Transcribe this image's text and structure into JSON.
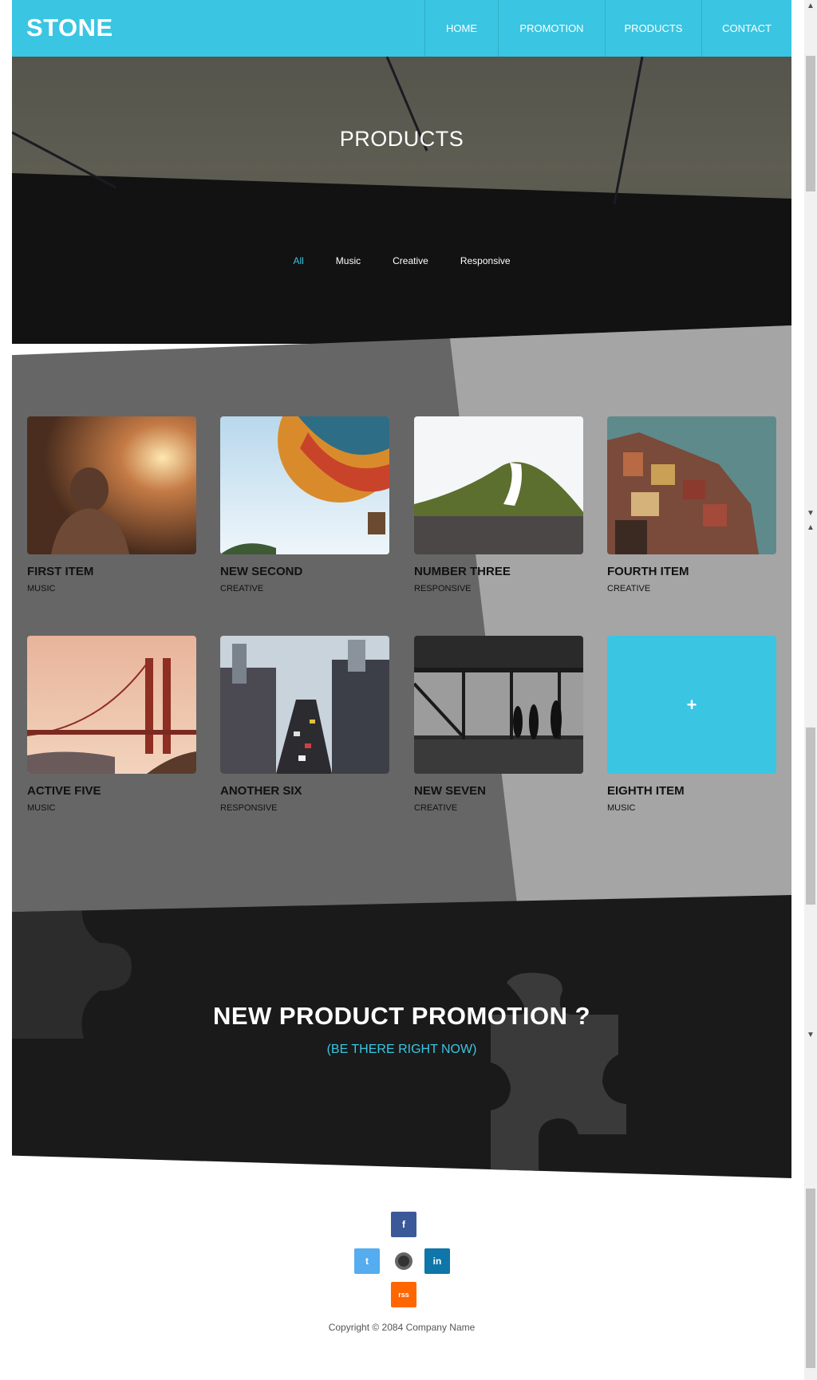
{
  "brand": "STONE",
  "nav": [
    "HOME",
    "PROMOTION",
    "PRODUCTS",
    "CONTACT"
  ],
  "hero": {
    "title": "PRODUCTS"
  },
  "filters": [
    "All",
    "Music",
    "Creative",
    "Responsive"
  ],
  "items": [
    {
      "title": "FIRST ITEM",
      "category": "MUSIC"
    },
    {
      "title": "NEW SECOND",
      "category": "CREATIVE"
    },
    {
      "title": "NUMBER THREE",
      "category": "RESPONSIVE"
    },
    {
      "title": "FOURTH ITEM",
      "category": "CREATIVE"
    },
    {
      "title": "ACTIVE FIVE",
      "category": "MUSIC"
    },
    {
      "title": "ANOTHER SIX",
      "category": "RESPONSIVE"
    },
    {
      "title": "NEW SEVEN",
      "category": "CREATIVE"
    },
    {
      "title": "EIGHTH ITEM",
      "category": "MUSIC",
      "icon": "plus-icon",
      "symbol": "+"
    }
  ],
  "promotion": {
    "title": "NEW PRODUCT PROMOTION ?",
    "subtitle": "(BE THERE RIGHT NOW)"
  },
  "footer": {
    "social": [
      {
        "name": "facebook",
        "glyph": "f",
        "color": "#3b5998"
      },
      {
        "name": "twitter",
        "glyph": "t",
        "color": "#55acee"
      },
      {
        "name": "linkedin",
        "glyph": "in",
        "color": "#0e76a8"
      },
      {
        "name": "rss",
        "glyph": "rss",
        "color": "#ff6600"
      }
    ],
    "copyright": "Copyright © 2084 Company Name"
  },
  "colors": {
    "accent": "#3ac5e2",
    "dark": "#1a1a1a"
  }
}
